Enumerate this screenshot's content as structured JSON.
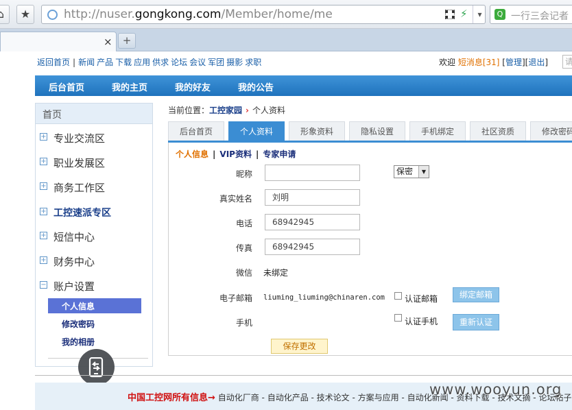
{
  "browser": {
    "url_prefix": "http://nuser.",
    "url_domain": "gongkong.com",
    "url_path": "/Member/home/me",
    "search_placeholder": "一行三会记者",
    "tab_close": "×",
    "tab_new": "+"
  },
  "topnav": {
    "home": "返回首页",
    "links": [
      "新闻",
      "产品",
      "下载",
      "应用",
      "供求",
      "论坛",
      "会议",
      "军团",
      "摄影",
      "求职"
    ],
    "sep": "|",
    "welcome": "欢迎",
    "messages": "短消息[31]",
    "manage": "管理",
    "logout": "退出",
    "search_hint": "请"
  },
  "bluebar": [
    "后台首页",
    "我的主页",
    "我的好友",
    "我的公告"
  ],
  "sidebar": {
    "header": "首页",
    "items": [
      "专业交流区",
      "职业发展区",
      "商务工作区",
      "工控速派专区",
      "短信中心",
      "财务中心",
      "账户设置"
    ],
    "subitems": [
      "个人信息",
      "修改密码",
      "我的相册"
    ]
  },
  "breadcrumb": {
    "prefix": "当前位置：",
    "home": "工控家园",
    "arrow": "›",
    "current": "个人资料"
  },
  "tabs": [
    "后台首页",
    "个人资料",
    "形象资料",
    "隐私设置",
    "手机绑定",
    "社区资质",
    "修改密码"
  ],
  "subnav": {
    "personal": "个人信息",
    "vip": "VIP资料",
    "expert": "专家申请",
    "sep": "|"
  },
  "form": {
    "nickname_label": "昵称",
    "nickname_value": "",
    "privacy_option": "保密",
    "realname_label": "真实姓名",
    "realname_value": "刘明",
    "phone_label": "电话",
    "phone_value": "68942945",
    "fax_label": "传真",
    "fax_value": "68942945",
    "wechat_label": "微信",
    "wechat_value": "未绑定",
    "email_label": "电子邮箱",
    "email_value": "liuming_liuming@chinaren.com",
    "verify_email_label": "认证邮箱",
    "bind_email_button": "绑定邮箱",
    "mobile_label": "手机",
    "mobile_value": "",
    "verify_mobile_label": "认证手机",
    "reverify_button": "重新认证",
    "save_button": "保存更改"
  },
  "footer": {
    "lead": "中国工控网所有信息→",
    "links": "自动化厂商 - 自动化产品 - 技术论文 - 方案与应用 - 自动化新闻 - 资料下载 - 技术文摘 - 论坛帖子"
  },
  "watermark": "www.wooyun.org"
}
